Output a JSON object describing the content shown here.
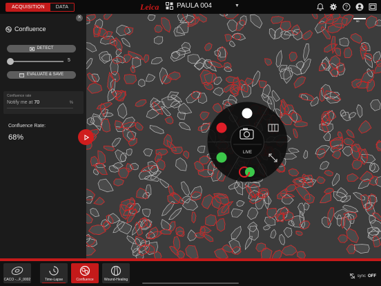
{
  "topbar": {
    "tabs": [
      {
        "label": "ACQUISITION",
        "active": true
      },
      {
        "label": "DATA",
        "active": false
      }
    ],
    "brand": "Leica",
    "project_name": "PAULA 004",
    "icons": [
      "project-icon",
      "chevron-down-icon",
      "bell-icon",
      "gear-icon",
      "help-icon",
      "user-icon",
      "gallery-icon"
    ]
  },
  "panel": {
    "title": "Confluence",
    "detect_label": "DETECT",
    "slider_value": "5",
    "slider_level": 0.0,
    "evaluate_label": "EVALUATE & SAVE",
    "notify": {
      "label": "Confluence rate",
      "prefix": "Notify me at",
      "value": "70",
      "unit": "%"
    },
    "confluence_label": "Confluence Rate:",
    "confluence_value": "68%"
  },
  "viewer": {
    "scale_label": "50"
  },
  "radial_menu": {
    "center_label": "LIVE",
    "channels": [
      {
        "name": "white",
        "color": "#ffffff"
      },
      {
        "name": "red",
        "color": "#e01e28"
      },
      {
        "name": "green",
        "color": "#3cc84a"
      }
    ]
  },
  "bottombar": {
    "tiles": [
      {
        "label": "CACO -...F_0002",
        "icon": "sample-icon",
        "state": "normal"
      },
      {
        "label": "Time-Lapse",
        "icon": "time-lapse-icon",
        "state": "underline"
      },
      {
        "label": "Confluence",
        "icon": "confluence-icon",
        "state": "active"
      },
      {
        "label": "Wound-Healing",
        "icon": "wound-healing-icon",
        "state": "normal"
      }
    ],
    "sync_label": "sync",
    "sync_state": "OFF"
  },
  "colors": {
    "accent": "#c41a1a",
    "panel_bg": "#1b1b1b",
    "overlay_outline": "#d01818"
  }
}
